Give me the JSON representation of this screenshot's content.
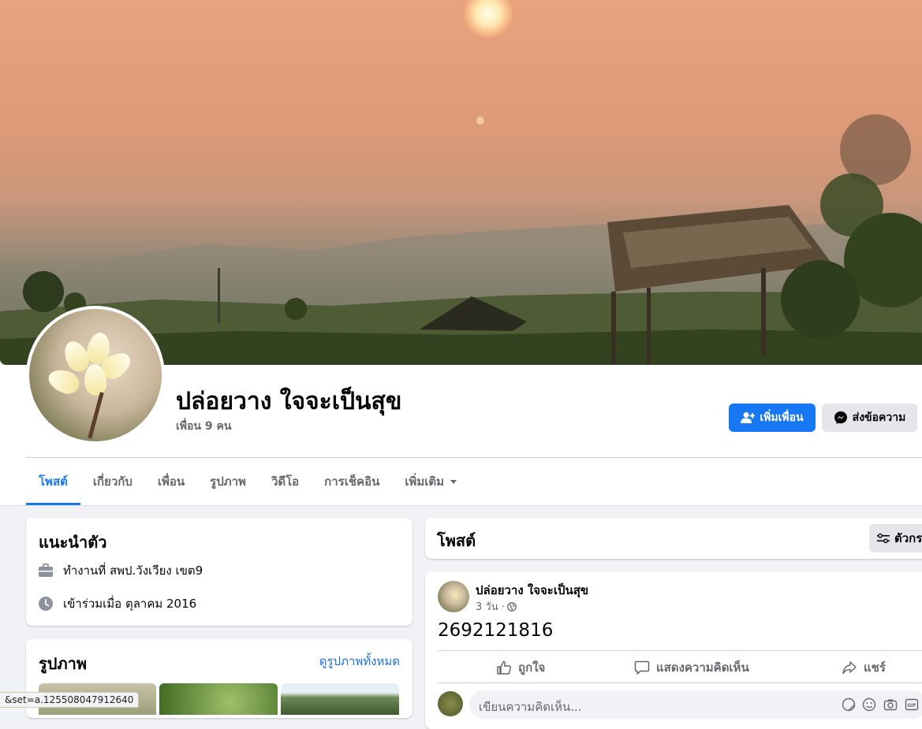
{
  "profile": {
    "name": "ปล่อยวาง ใจจะเป็นสุข",
    "friends_count": "เพื่อน 9 คน",
    "add_friend_label": "เพิ่มเพื่อน",
    "message_label": "ส่งข้อความ"
  },
  "tabs": [
    {
      "label": "โพสต์",
      "active": true
    },
    {
      "label": "เกี่ยวกับ",
      "active": false
    },
    {
      "label": "เพื่อน",
      "active": false
    },
    {
      "label": "รูปภาพ",
      "active": false
    },
    {
      "label": "วิดีโอ",
      "active": false
    },
    {
      "label": "การเช็คอิน",
      "active": false
    },
    {
      "label": "เพิ่มเติม",
      "active": false
    }
  ],
  "intro": {
    "title": "แนะนำตัว",
    "work": "ทำงานที่ สพป.วังเวียง เขต9",
    "joined": "เข้าร่วมเมื่อ ตุลาคม 2016"
  },
  "photos": {
    "title": "รูปภาพ",
    "see_all": "ดูรูปภาพทั้งหมด"
  },
  "posts_header": {
    "title": "โพสต์",
    "filter_label": "ตัวกร"
  },
  "post": {
    "author": "ปล่อยวาง ใจจะเป็นสุข",
    "time": "3 วัน ·",
    "text": "2692121816",
    "like_label": "ถูกใจ",
    "comment_label": "แสดงความคิดเห็น",
    "share_label": "แชร์",
    "comment_placeholder": "เขียนความคิดเห็น..."
  },
  "status_bar": "&set=a.125508047912640",
  "colors": {
    "accent": "#1877f2",
    "background": "#f0f2f5",
    "secondary_text": "#65676b"
  }
}
